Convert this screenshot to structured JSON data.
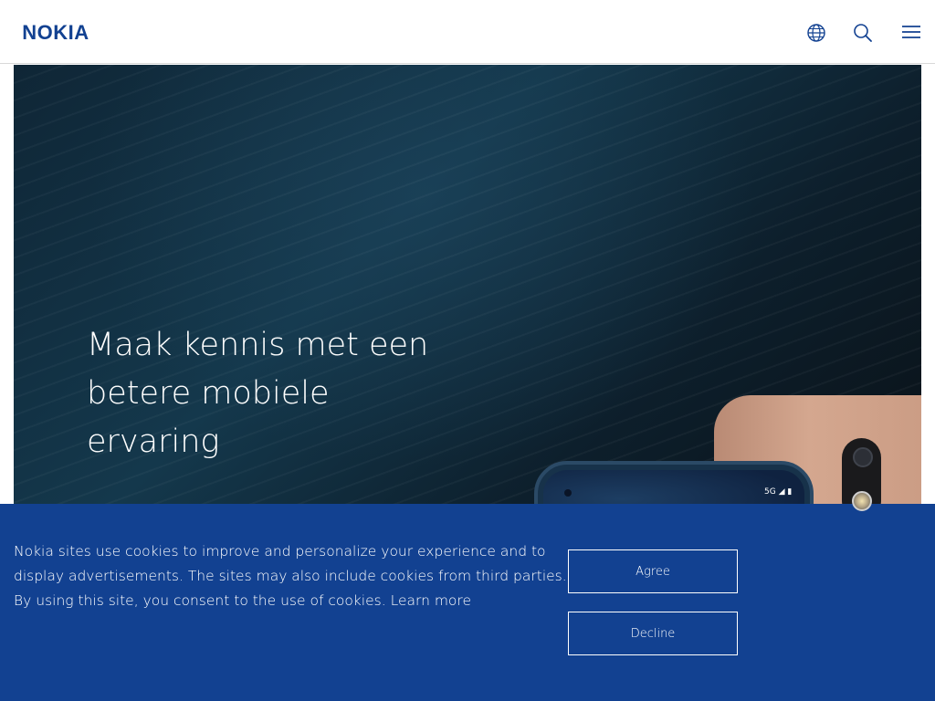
{
  "header": {
    "logo_text": "NOKIA",
    "logo_color": "#124191",
    "icons": {
      "language": "globe-icon",
      "search": "search-icon",
      "menu": "hamburger-menu-icon"
    }
  },
  "hero": {
    "headline_lines": [
      "Maak kennis met een",
      "betere mobiele",
      "ervaring"
    ],
    "phone_status": "5G"
  },
  "cookie_banner": {
    "lines": [
      "Nokia sites use cookies to improve and personalize your experience and to",
      "display advertisements. The sites may also include cookies from third parties.",
      "By using this site, you consent to the use of cookies."
    ],
    "learn_more": "Learn more",
    "agree_label": "Agree",
    "decline_label": "Decline",
    "background_color": "#124191"
  }
}
